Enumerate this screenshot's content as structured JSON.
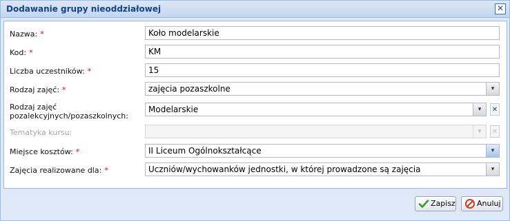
{
  "dialog": {
    "title": "Dodawanie grupy nieoddziałowej",
    "close_symbol": "✕"
  },
  "form": {
    "required_marker": "*",
    "fields": [
      {
        "label": "Nazwa:",
        "required": true,
        "type": "text",
        "value": "Koło modelarskie"
      },
      {
        "label": "Kod:",
        "required": true,
        "type": "text",
        "value": "KM"
      },
      {
        "label": "Liczba uczestników:",
        "required": true,
        "type": "text",
        "value": "15"
      },
      {
        "label": "Rodzaj zajęć:",
        "required": true,
        "type": "combo",
        "value": "zajęcia pozaszkolne"
      },
      {
        "label_line1": "Rodzaj zajęć",
        "label_line2": "pozalekcyjnych/pozaszkolnych:",
        "required": false,
        "type": "combo-clear",
        "value": "Modelarskie"
      },
      {
        "label": "Tematyka kursu:",
        "required": false,
        "type": "combo-clear",
        "disabled": true,
        "value": ""
      },
      {
        "label": "Miejsce kosztów:",
        "required": true,
        "type": "combo",
        "value": "II Liceum Ogólnokształcące"
      },
      {
        "label": "Zajęcia realizowane dla:",
        "required": true,
        "type": "combo",
        "value": "Uczniów/wychowanków jednostki, w której prowadzone są  zajęcia"
      }
    ]
  },
  "footer": {
    "save_label": "Zapisz",
    "cancel_label": "Anuluj"
  },
  "icons": {
    "dropdown": "▾",
    "clear": "✕"
  },
  "colors": {
    "title_text": "#15428b",
    "required": "#e00000",
    "panel_border": "#99bbe8"
  }
}
